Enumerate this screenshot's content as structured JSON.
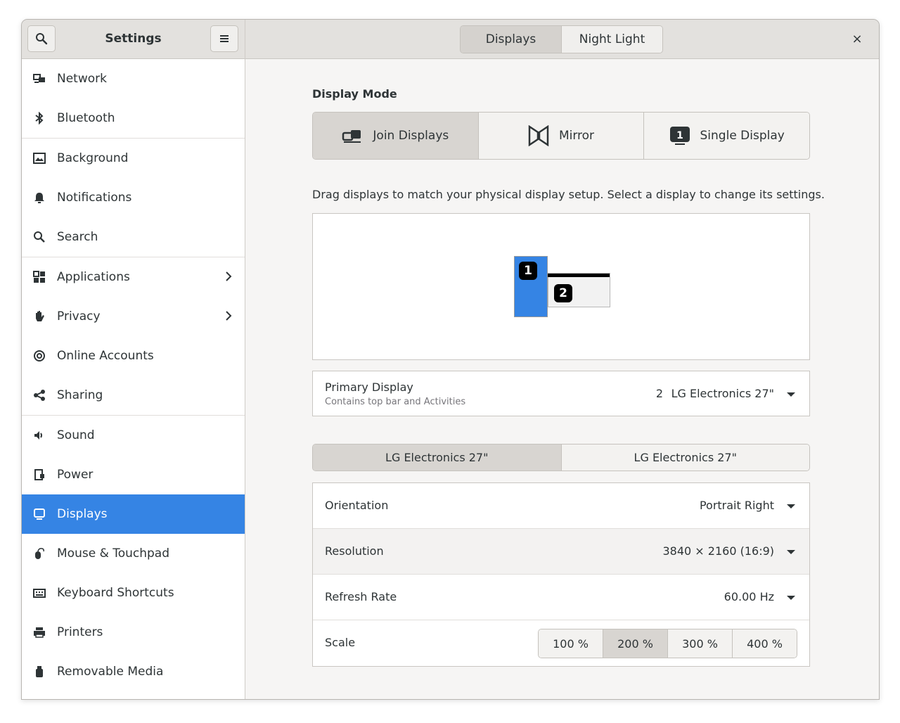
{
  "header": {
    "title": "Settings",
    "tabs": [
      {
        "label": "Displays",
        "active": true
      },
      {
        "label": "Night Light",
        "active": false
      }
    ],
    "close_label": "×"
  },
  "sidebar": {
    "items": [
      {
        "label": "Network",
        "icon": "network-icon"
      },
      {
        "label": "Bluetooth",
        "icon": "bluetooth-icon"
      },
      {
        "label": "Background",
        "icon": "background-icon"
      },
      {
        "label": "Notifications",
        "icon": "bell-icon"
      },
      {
        "label": "Search",
        "icon": "search-icon"
      },
      {
        "label": "Applications",
        "icon": "applications-icon"
      },
      {
        "label": "Privacy",
        "icon": "hand-icon"
      },
      {
        "label": "Online Accounts",
        "icon": "at-icon"
      },
      {
        "label": "Sharing",
        "icon": "share-icon"
      },
      {
        "label": "Sound",
        "icon": "speaker-icon"
      },
      {
        "label": "Power",
        "icon": "power-icon"
      },
      {
        "label": "Displays",
        "icon": "display-icon"
      },
      {
        "label": "Mouse & Touchpad",
        "icon": "mouse-icon"
      },
      {
        "label": "Keyboard Shortcuts",
        "icon": "keyboard-icon"
      },
      {
        "label": "Printers",
        "icon": "printer-icon"
      },
      {
        "label": "Removable Media",
        "icon": "usb-icon"
      }
    ],
    "selected": "Displays",
    "accent": "#3584e4"
  },
  "display_mode": {
    "heading": "Display Mode",
    "modes": [
      {
        "label": "Join Displays",
        "icon": "join-displays-icon",
        "active": true
      },
      {
        "label": "Mirror",
        "icon": "mirror-icon",
        "active": false
      },
      {
        "label": "Single Display",
        "icon": "single-display-icon",
        "active": false
      }
    ]
  },
  "arrangement": {
    "hint": "Drag displays to match your physical display setup. Select a display to change its settings.",
    "monitor1_label": "1",
    "monitor2_label": "2"
  },
  "primary_display": {
    "title": "Primary Display",
    "subtitle": "Contains top bar and Activities",
    "number": "2",
    "value": "LG Electronics 27\""
  },
  "monitor_tabs": [
    {
      "label": "LG Electronics 27\"",
      "active": true
    },
    {
      "label": "LG Electronics 27\"",
      "active": false
    }
  ],
  "settings": {
    "orientation": {
      "label": "Orientation",
      "value": "Portrait Right"
    },
    "resolution": {
      "label": "Resolution",
      "value": "3840 × 2160 (16:9)"
    },
    "refresh_rate": {
      "label": "Refresh Rate",
      "value": "60.00 Hz"
    },
    "scale": {
      "label": "Scale",
      "options": [
        "100 %",
        "200 %",
        "300 %",
        "400 %"
      ],
      "selected": "200 %"
    }
  }
}
